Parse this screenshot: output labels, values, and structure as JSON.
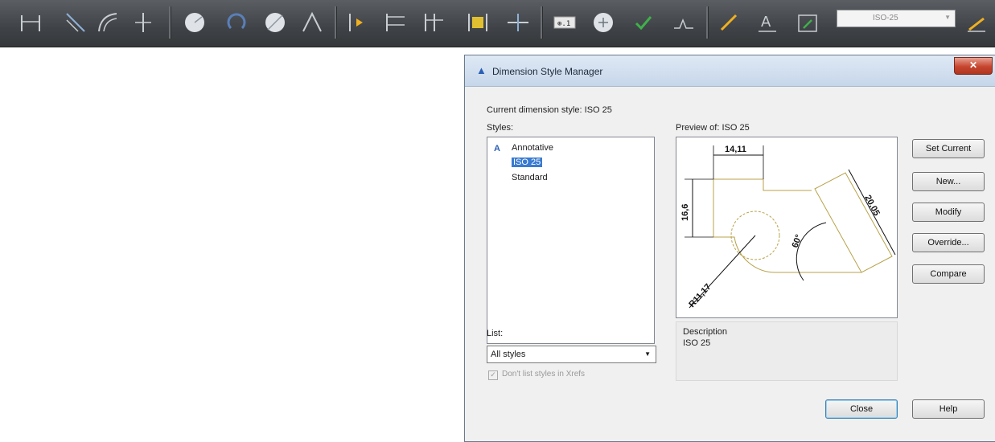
{
  "toolbar": {
    "dimension_style_value": "ISO-25",
    "icons": [
      "linear-dimension-icon",
      "aligned-dimension-icon",
      "arc-length-icon",
      "ordinate-icon",
      "radius-icon",
      "jogged-icon",
      "diameter-icon",
      "angular-icon",
      "quick-dimension-icon",
      "baseline-icon",
      "continue-icon",
      "dimension-space-icon",
      "dimension-break-icon",
      "tolerance-icon",
      "center-mark-icon",
      "inspection-icon",
      "jogged-linear-icon",
      "dimension-edit-icon",
      "dimension-text-edit-icon",
      "dimension-update-icon",
      "dimension-style-icon"
    ]
  },
  "dialog": {
    "title": "Dimension Style Manager",
    "close_label": "✕",
    "current_style": "Current dimension style: ISO 25",
    "styles_label": "Styles:",
    "styles": [
      "Annotative",
      "ISO 25",
      "Standard"
    ],
    "selected_style": "ISO 25",
    "preview_label": "Preview of: ISO 25",
    "list_label": "List:",
    "list_value": "All styles",
    "dont_list_xrefs": "Don't list styles in Xrefs",
    "description_label": "Description",
    "description_value": "ISO 25",
    "buttons": {
      "set_current": "Set Current",
      "new": "New...",
      "modify": "Modify",
      "override": "Override...",
      "compare": "Compare",
      "close": "Close",
      "help": "Help"
    },
    "preview_dims": {
      "top": "14,11",
      "left": "16,6",
      "right": "20,05",
      "angle": "60°",
      "radius": "R11,17"
    }
  },
  "colors": {
    "toolbar_bg": "#3f4347",
    "titlebar_bg": "#c6d6ea",
    "selection": "#3a7bd0",
    "preview_geometry": "#b8a24a"
  }
}
